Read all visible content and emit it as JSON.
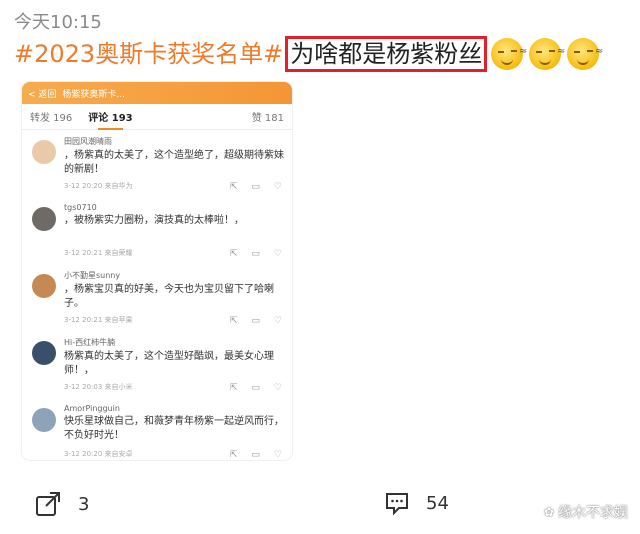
{
  "post": {
    "timestamp": "今天10:15",
    "hashtag": "#2023奥斯卡获奖名单#",
    "highlight_text": "为啥都是杨紫粉丝",
    "emoji_icons": [
      "sweat-smile-icon",
      "sweat-smile-icon",
      "sweat-smile-icon"
    ]
  },
  "screenshot": {
    "top_bar_back": "< 返回",
    "top_bar_title": "杨紫获奥斯卡...",
    "tabs": {
      "repost": "转发 196",
      "comments": "评论 193",
      "likes": "赞 181"
    },
    "comments": [
      {
        "user": "田园风潮晴雨",
        "text": "，杨紫真的太美了，这个造型绝了，超级期待紫妹的新剧！",
        "meta": "3-12 20:20  来自华为",
        "avatar_color": "#e9c9a8"
      },
      {
        "user": "tgs0710",
        "text": "，被杨紫实力圈粉，演技真的太棒啦！，",
        "meta": "3-12 20:21  来自荣耀",
        "avatar_color": "#6f6a66"
      },
      {
        "user": "小不勤星sunny",
        "text": "，杨紫宝贝真的好美，今天也为宝贝留下了哈喇子。",
        "meta": "3-12 20:21  来自苹果",
        "avatar_color": "#c58a54"
      },
      {
        "user": "Hi-西红柿牛腩",
        "text": "杨紫真的太美了，这个造型好酷飒，最美女心理师！，",
        "meta": "3-12 20:03  来自小米",
        "avatar_color": "#3a4f6a"
      },
      {
        "user": "AmorPingguin",
        "text": "快乐星球做自己，和薇梦青年杨紫一起逆风而行，不负好时光！",
        "meta": "3-12 20:20  来自安卓",
        "avatar_color": "#8ea2b8"
      }
    ]
  },
  "footer": {
    "share_count": "3",
    "comment_count": "54",
    "watermark": "缘木不求娱"
  }
}
